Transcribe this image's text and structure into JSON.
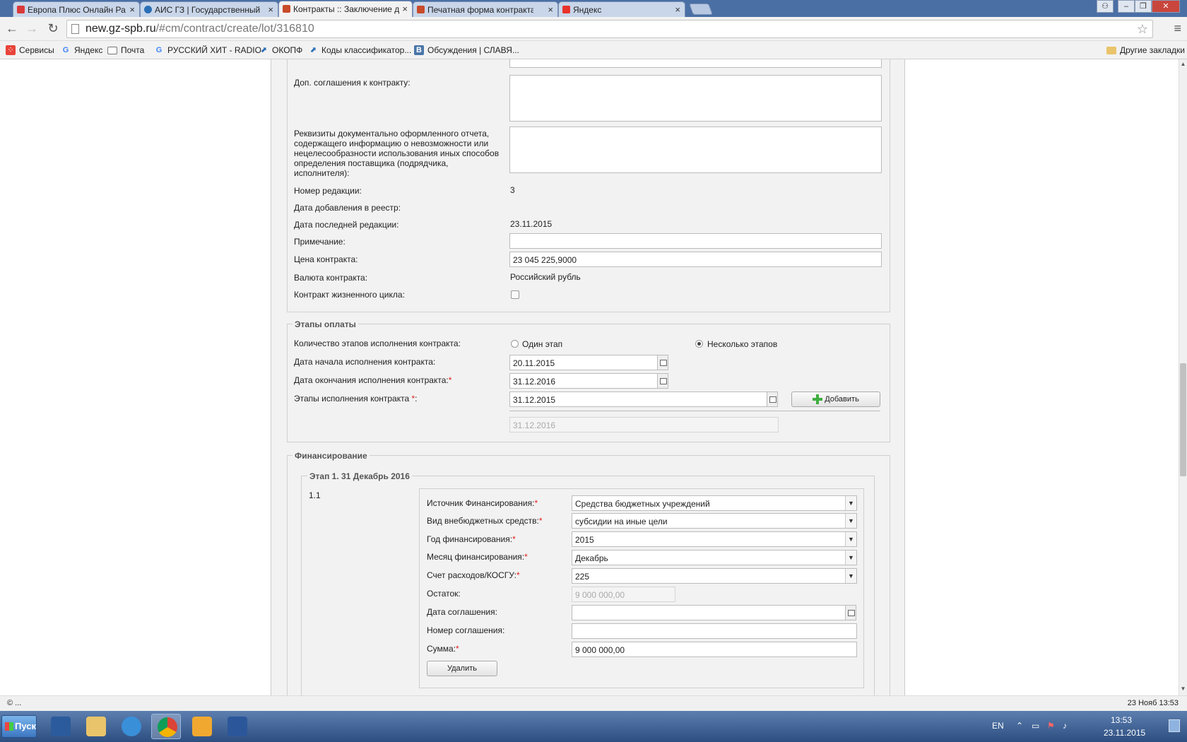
{
  "browser": {
    "tabs": [
      {
        "title": "Европа Плюс Онлайн Ра",
        "favicon_color": "#d93a3a"
      },
      {
        "title": "АИС ГЗ | Государственный",
        "favicon_color": "#2a6fb5"
      },
      {
        "title": "Контракты :: Заключение д",
        "favicon_color": "#c84b2a"
      },
      {
        "title": "Печатная форма контракта",
        "favicon_color": "#c84b2a"
      },
      {
        "title": "Яндекс",
        "favicon_color": "#e8332a"
      }
    ],
    "address": {
      "host": "new.gz-spb.ru",
      "path": "/#cm/contract/create/lot/316810"
    },
    "bookmarks": [
      {
        "label": "Сервисы",
        "icon": "apps-icon"
      },
      {
        "label": "Яндекс",
        "icon": "g-icon"
      },
      {
        "label": "Почта",
        "icon": "mail-icon"
      },
      {
        "label": "РУССКИЙ ХИТ - RADIO",
        "icon": "g-icon"
      },
      {
        "label": "ОКОПФ",
        "icon": "link-icon"
      },
      {
        "label": "Коды классификатор...",
        "icon": "link-icon"
      },
      {
        "label": "Обсуждения | СЛАВЯ...",
        "icon": "vk-icon"
      }
    ],
    "other_bookmarks": "Другие закладки",
    "status_left": "© ...",
    "status_right": "23 Нояб 13:53"
  },
  "form": {
    "dop_soglasheniya": "Доп. соглашения к контракту:",
    "rekvizity": "Реквизиты документально оформленного отчета, содержащего информацию о невозможности или нецелесообразности использования иных способов определения поставщика (подрядчика, исполнителя):",
    "nomer_redakcii_label": "Номер редакции:",
    "nomer_redakcii_value": "3",
    "data_dobavleniya_label": "Дата добавления в реестр:",
    "data_posledney_label": "Дата последней редакции:",
    "data_posledney_value": "23.11.2015",
    "primechanie_label": "Примечание:",
    "primechanie_value": "",
    "cena_label": "Цена контракта:",
    "cena_value": "23 045 225,9000",
    "valyuta_label": "Валюта контракта:",
    "valyuta_value": "Российский рубль",
    "zhiznenniy_label": "Контракт жизненного цикла:"
  },
  "payment": {
    "legend": "Этапы оплаты",
    "kolichestvo_label": "Количество этапов исполнения контракта:",
    "option_one": "Один этап",
    "option_many": "Несколько этапов",
    "selected": "many",
    "nachalo_label": "Дата начала исполнения контракта:",
    "nachalo_value": "20.11.2015",
    "okonchanie_label": "Дата окончания исполнения контракта:",
    "okonchanie_value": "31.12.2016",
    "etapy_label": "Этапы исполнения контракта",
    "etapy_value": "31.12.2015",
    "add_button": "Добавить",
    "etap_disabled": "31.12.2016"
  },
  "financing": {
    "legend": "Финансирование",
    "stage_legend": "Этап 1. 31 Декабрь 2016",
    "row_number": "1.1",
    "istochnik_label": "Источник Финансирования:",
    "istochnik_value": "Средства бюджетных учреждений",
    "vid_label": "Вид внебюджетных средств:",
    "vid_value": "субсидии на иные цели",
    "god_label": "Год финансирования:",
    "god_value": "2015",
    "mesyac_label": "Месяц финансирования:",
    "mesyac_value": "Декабрь",
    "schet_label": "Счет расходов/КОСГУ:",
    "schet_value": "225",
    "ostatok_label": "Остаток:",
    "ostatok_value": "9 000 000,00",
    "data_soglasheniya_label": "Дата соглашения:",
    "nomer_soglasheniya_label": "Номер соглашения:",
    "summa_label": "Сумма:",
    "summa_value": "9 000 000,00",
    "delete_button": "Удалить"
  },
  "taskbar": {
    "start": "Пуск",
    "lang": "EN",
    "time": "13:53",
    "date": "23.11.2015"
  }
}
